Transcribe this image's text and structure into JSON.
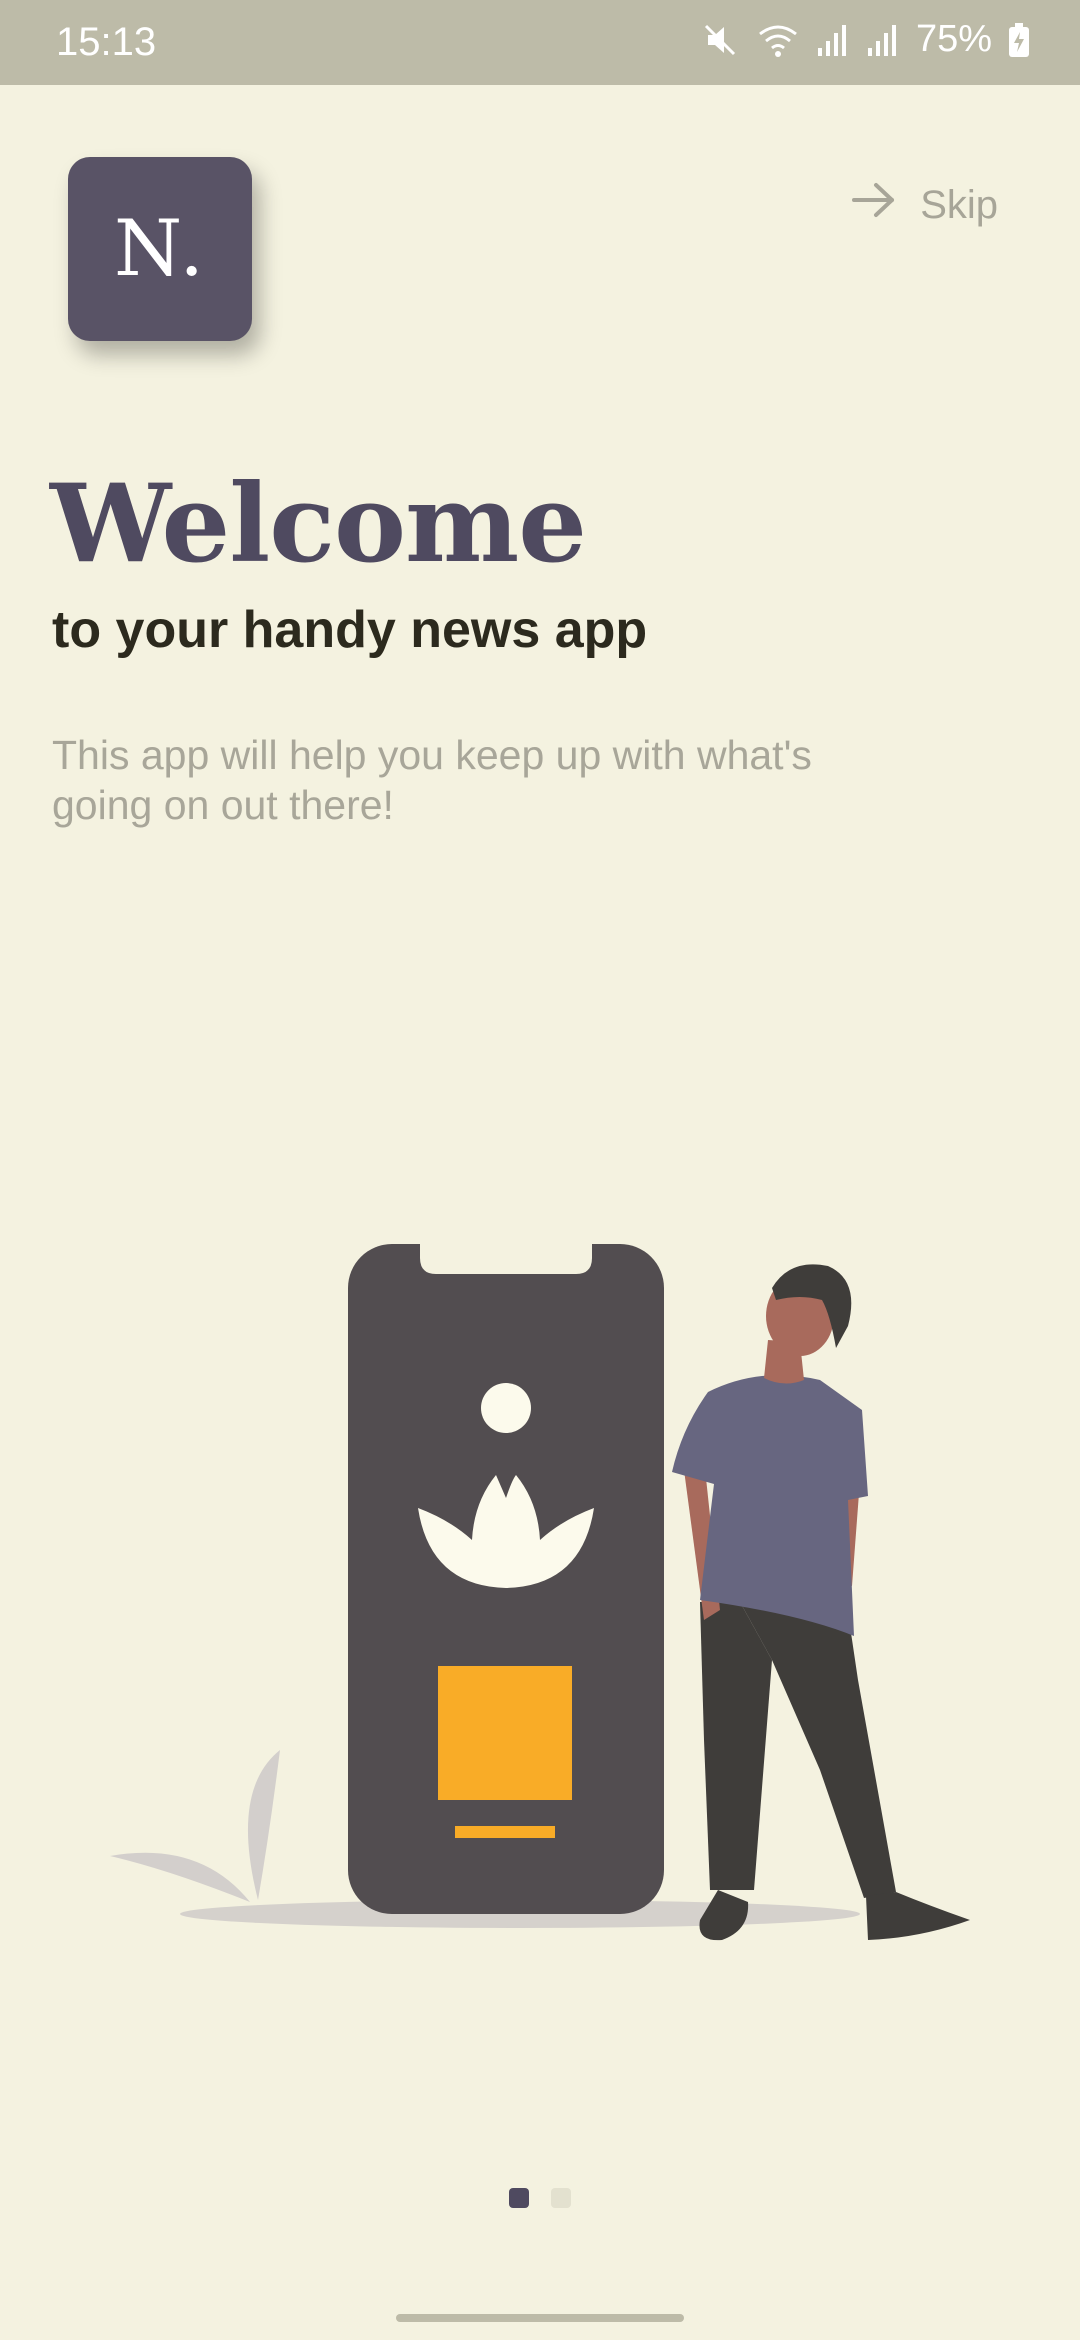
{
  "status_bar": {
    "time": "15:13",
    "battery": "75%"
  },
  "logo": {
    "text": "N."
  },
  "skip": {
    "label": "Skip"
  },
  "welcome": {
    "title": "Welcome",
    "subtitle": "to your handy news app",
    "description": "This app will help you keep up with what's going on out there!"
  },
  "pager": {
    "current": 1,
    "total": 2
  },
  "colors": {
    "background": "#F4F2E0",
    "accent": "#4F4A60",
    "phone": "#524D50",
    "highlight": "#F9AC27"
  }
}
